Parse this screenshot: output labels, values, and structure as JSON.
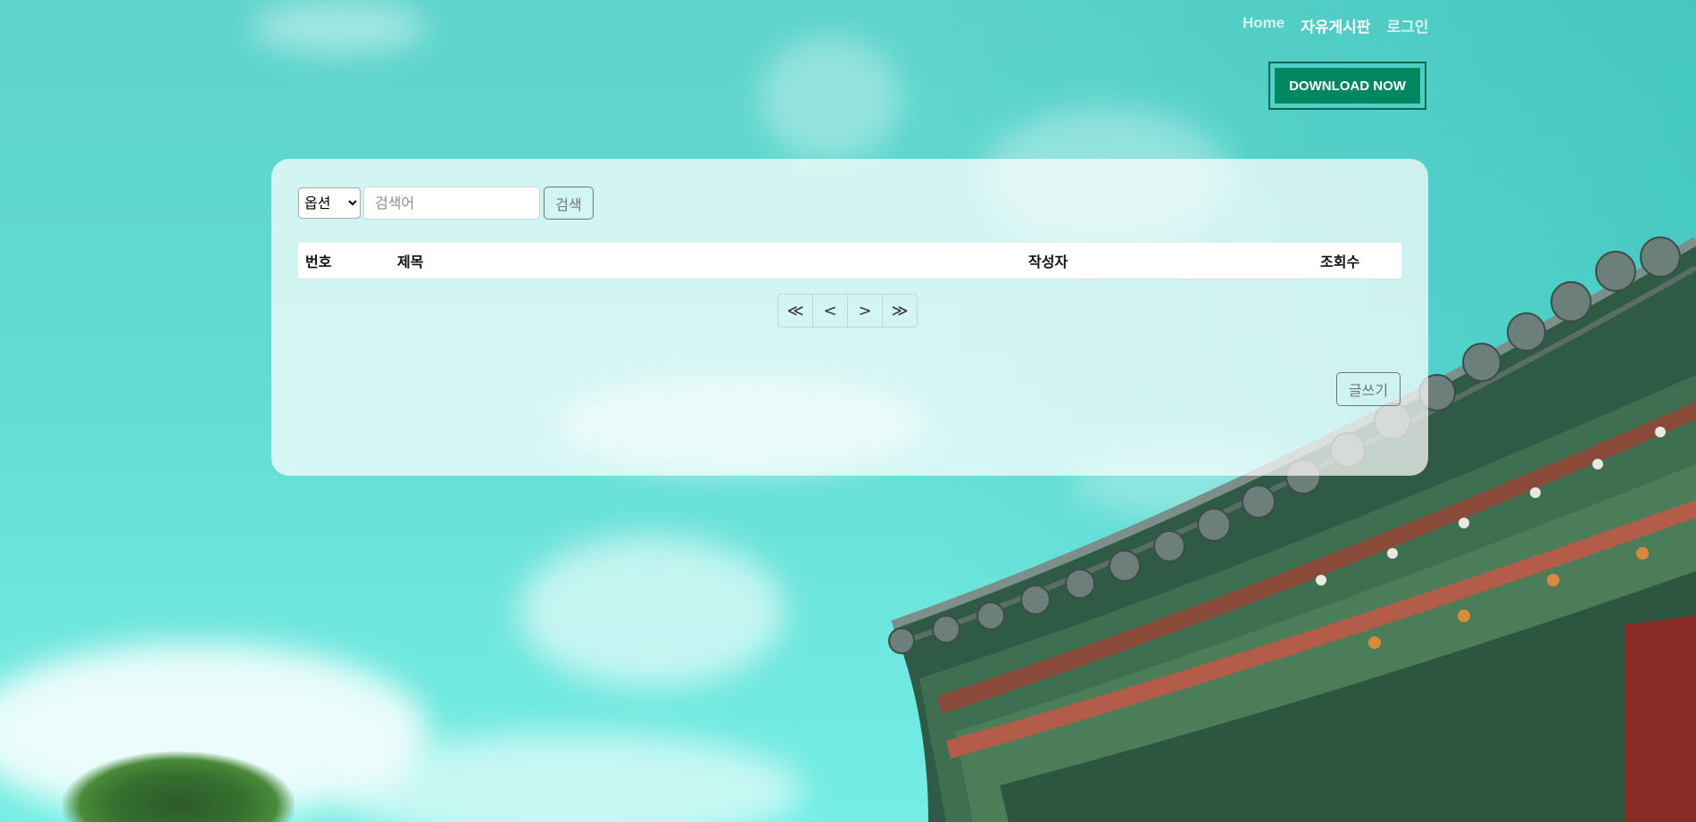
{
  "nav": {
    "items": [
      {
        "label": "Home",
        "active": false
      },
      {
        "label": "자유게시판",
        "active": true
      },
      {
        "label": "로그인",
        "active": false
      }
    ]
  },
  "download": {
    "label": "DOWNLOAD NOW"
  },
  "search": {
    "select_value": "옵션",
    "placeholder": "검색어",
    "button_label": "검색"
  },
  "table": {
    "headers": [
      "번호",
      "제목",
      "작성자",
      "조회수"
    ]
  },
  "pagination": {
    "first": "≪",
    "prev": "<",
    "next": ">",
    "last": "≫"
  },
  "write": {
    "label": "글쓰기"
  },
  "colors": {
    "accent": "#00875f",
    "sky": "#5cd3cb"
  }
}
